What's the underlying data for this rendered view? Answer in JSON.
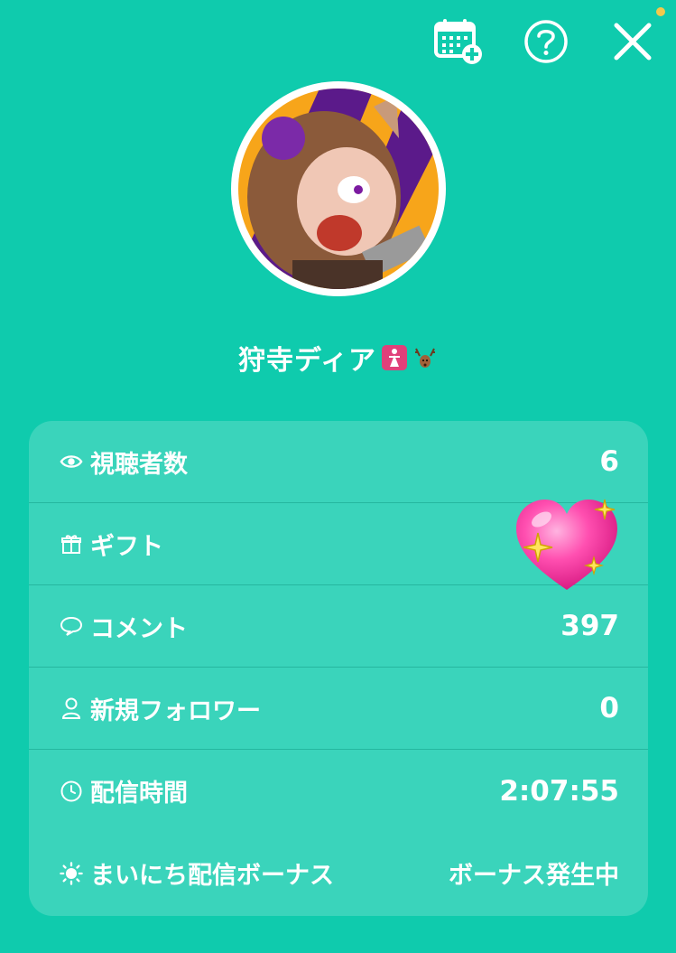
{
  "header": {
    "icons": [
      "calendar-add-icon",
      "help-icon",
      "close-icon"
    ]
  },
  "profile": {
    "name": "狩寺ディア",
    "name_emojis": [
      "girl-restroom-emoji",
      "deer-emoji"
    ]
  },
  "stats": [
    {
      "icon": "eye-icon",
      "label": "視聴者数",
      "value": "6"
    },
    {
      "icon": "gift-icon",
      "label": "ギフト",
      "value": ""
    },
    {
      "icon": "comment-icon",
      "label": "コメント",
      "value": "397"
    },
    {
      "icon": "user-icon",
      "label": "新規フォロワー",
      "value": "0"
    },
    {
      "icon": "clock-icon",
      "label": "配信時間",
      "value": "2:07:55"
    },
    {
      "icon": "sun-icon",
      "label": "まいにち配信ボーナス",
      "value": "ボーナス発生中"
    }
  ],
  "colors": {
    "background": "#0fcbad",
    "card": "#3ad8bf",
    "text": "#ffffff"
  }
}
